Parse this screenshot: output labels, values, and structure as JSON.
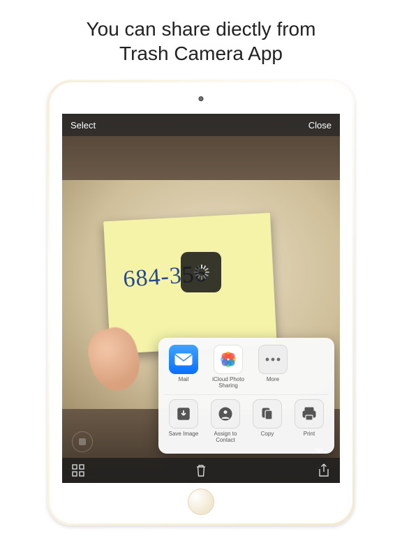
{
  "headline": {
    "line1": "You can share diectly from",
    "line2": "Trash Camera App"
  },
  "navbar": {
    "select_label": "Select",
    "close_label": "Close"
  },
  "note": {
    "text": "684-356"
  },
  "share_sheet": {
    "apps": [
      {
        "label": "Mail",
        "icon": "mail-icon"
      },
      {
        "label": "iCloud Photo Sharing",
        "icon": "photos-icon"
      },
      {
        "label": "More",
        "icon": "more-icon"
      }
    ],
    "actions": [
      {
        "label": "Save Image",
        "icon": "save-image-icon"
      },
      {
        "label": "Assign to Contact",
        "icon": "contact-icon"
      },
      {
        "label": "Copy",
        "icon": "copy-icon"
      },
      {
        "label": "Print",
        "icon": "print-icon"
      }
    ]
  },
  "toolbar": {
    "grid": "grid-icon",
    "trash": "trash-icon",
    "share": "share-icon"
  }
}
